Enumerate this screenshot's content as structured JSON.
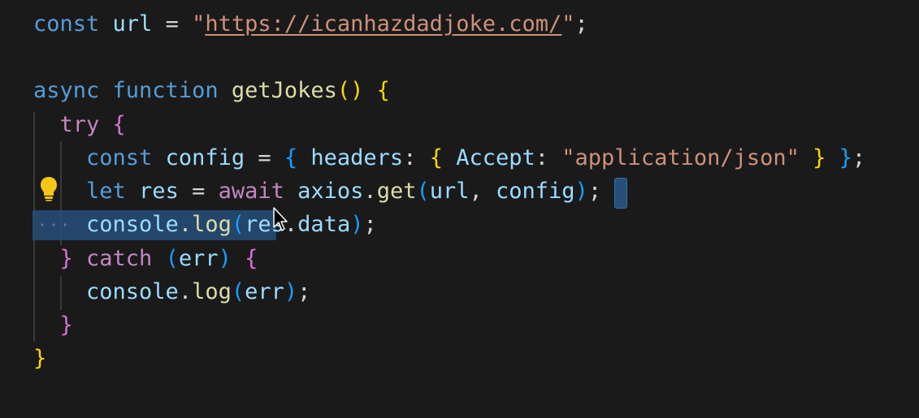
{
  "editor": {
    "lines": [
      {
        "id": "line-url",
        "tokens": [
          {
            "t": "const",
            "c": "kw-blue"
          },
          {
            "t": " url ",
            "c": "var"
          },
          {
            "t": "= ",
            "c": "punc"
          },
          {
            "t": "\"",
            "c": "str"
          },
          {
            "t": "https://icanhazdadjoke.com/",
            "c": "str url-under"
          },
          {
            "t": "\"",
            "c": "str"
          },
          {
            "t": ";",
            "c": "punc"
          }
        ]
      },
      {
        "id": "line-blank-1",
        "tokens": []
      },
      {
        "id": "line-async",
        "tokens": [
          {
            "t": "async",
            "c": "kw-blue"
          },
          {
            "t": " function ",
            "c": "kw-blue"
          },
          {
            "t": "getJokes",
            "c": "fn"
          },
          {
            "t": "() ",
            "c": "b1"
          },
          {
            "t": "{",
            "c": "b1"
          }
        ]
      },
      {
        "id": "line-try",
        "tokens": [
          {
            "t": "  try",
            "c": "kw-pink"
          },
          {
            "t": " {",
            "c": "b2"
          }
        ]
      },
      {
        "id": "line-config",
        "tokens": [
          {
            "t": "    const",
            "c": "kw-blue"
          },
          {
            "t": " config ",
            "c": "var"
          },
          {
            "t": "= ",
            "c": "punc"
          },
          {
            "t": "{ ",
            "c": "b3"
          },
          {
            "t": "headers",
            "c": "var"
          },
          {
            "t": ": ",
            "c": "punc"
          },
          {
            "t": "{ ",
            "c": "b1"
          },
          {
            "t": "Accept",
            "c": "var"
          },
          {
            "t": ": ",
            "c": "punc"
          },
          {
            "t": "\"application/json\"",
            "c": "str"
          },
          {
            "t": " }",
            "c": "b1"
          },
          {
            "t": " }",
            "c": "b3"
          },
          {
            "t": ";",
            "c": "punc"
          }
        ]
      },
      {
        "id": "line-let",
        "tokens": [
          {
            "t": "    let",
            "c": "kw-blue"
          },
          {
            "t": " res ",
            "c": "var"
          },
          {
            "t": "= ",
            "c": "punc"
          },
          {
            "t": "await",
            "c": "kw-pink"
          },
          {
            "t": " axios",
            "c": "var"
          },
          {
            "t": ".",
            "c": "punc"
          },
          {
            "t": "get",
            "c": "fn"
          },
          {
            "t": "(",
            "c": "b3"
          },
          {
            "t": "url",
            "c": "var"
          },
          {
            "t": ", ",
            "c": "punc"
          },
          {
            "t": "config",
            "c": "var"
          },
          {
            "t": ")",
            "c": "b3"
          },
          {
            "t": ";",
            "c": "punc"
          }
        ]
      },
      {
        "id": "line-console-res",
        "tokens": [
          {
            "t": "    console",
            "c": "var"
          },
          {
            "t": ".",
            "c": "punc"
          },
          {
            "t": "log",
            "c": "fn"
          },
          {
            "t": "(",
            "c": "b3"
          },
          {
            "t": "res",
            "c": "var"
          },
          {
            "t": ".",
            "c": "punc"
          },
          {
            "t": "data",
            "c": "var"
          },
          {
            "t": ")",
            "c": "b3"
          },
          {
            "t": ";",
            "c": "punc"
          }
        ]
      },
      {
        "id": "line-catch",
        "tokens": [
          {
            "t": "  }",
            "c": "b2"
          },
          {
            "t": " catch ",
            "c": "kw-pink"
          },
          {
            "t": "(",
            "c": "b3"
          },
          {
            "t": "err",
            "c": "var"
          },
          {
            "t": ") ",
            "c": "b3"
          },
          {
            "t": "{",
            "c": "b2"
          }
        ]
      },
      {
        "id": "line-console-err",
        "tokens": [
          {
            "t": "    console",
            "c": "var"
          },
          {
            "t": ".",
            "c": "punc"
          },
          {
            "t": "log",
            "c": "fn"
          },
          {
            "t": "(",
            "c": "b3"
          },
          {
            "t": "err",
            "c": "var"
          },
          {
            "t": ")",
            "c": "b3"
          },
          {
            "t": ";",
            "c": "punc"
          }
        ]
      },
      {
        "id": "line-close-catch",
        "tokens": [
          {
            "t": "  }",
            "c": "b2"
          }
        ]
      },
      {
        "id": "line-close-fn",
        "tokens": [
          {
            "t": "}",
            "c": "b1"
          }
        ]
      }
    ],
    "fold_dots": "···",
    "icons": {
      "lightbulb": "lightbulb-icon",
      "cursor": "mouse-pointer-icon"
    },
    "colors": {
      "background": "#1a1a1b",
      "selection": "#264f78",
      "keyword_blue": "#569cd6",
      "keyword_pink": "#c586c0",
      "variable": "#9cdcfe",
      "function": "#dcdcaa",
      "string": "#ce9178",
      "bracket_gold": "#ffd700",
      "bracket_purple": "#da70d6",
      "bracket_blue": "#179fff"
    }
  }
}
